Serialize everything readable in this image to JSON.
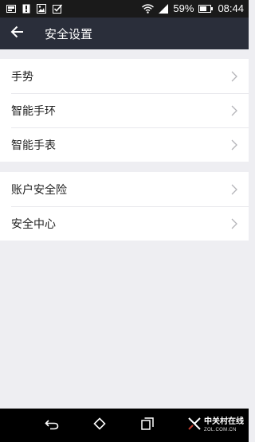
{
  "status_bar": {
    "battery_percent": "59%",
    "time": "08:44",
    "icons_left": [
      "screenshot-icon",
      "alert-download-icon",
      "gallery-icon",
      "checkbox-icon"
    ],
    "icons_right": [
      "wifi-icon",
      "signal-icon",
      "battery-icon"
    ]
  },
  "header": {
    "title": "安全设置",
    "back_icon": "arrow-left-icon",
    "background": "#2a2e3a"
  },
  "sections": [
    {
      "items": [
        {
          "label": "手势"
        },
        {
          "label": "智能手环"
        },
        {
          "label": "智能手表"
        }
      ]
    },
    {
      "items": [
        {
          "label": "账户安全险"
        },
        {
          "label": "安全中心"
        }
      ]
    }
  ],
  "nav_bar": {
    "buttons": [
      "back-icon",
      "home-icon",
      "recent-apps-icon"
    ]
  },
  "watermark": {
    "brand": "中关村在线",
    "domain": "ZOL.COM.CN"
  },
  "colors": {
    "page_background": "#eeeef2",
    "row_background": "#ffffff",
    "chevron": "#b4b4b8"
  }
}
